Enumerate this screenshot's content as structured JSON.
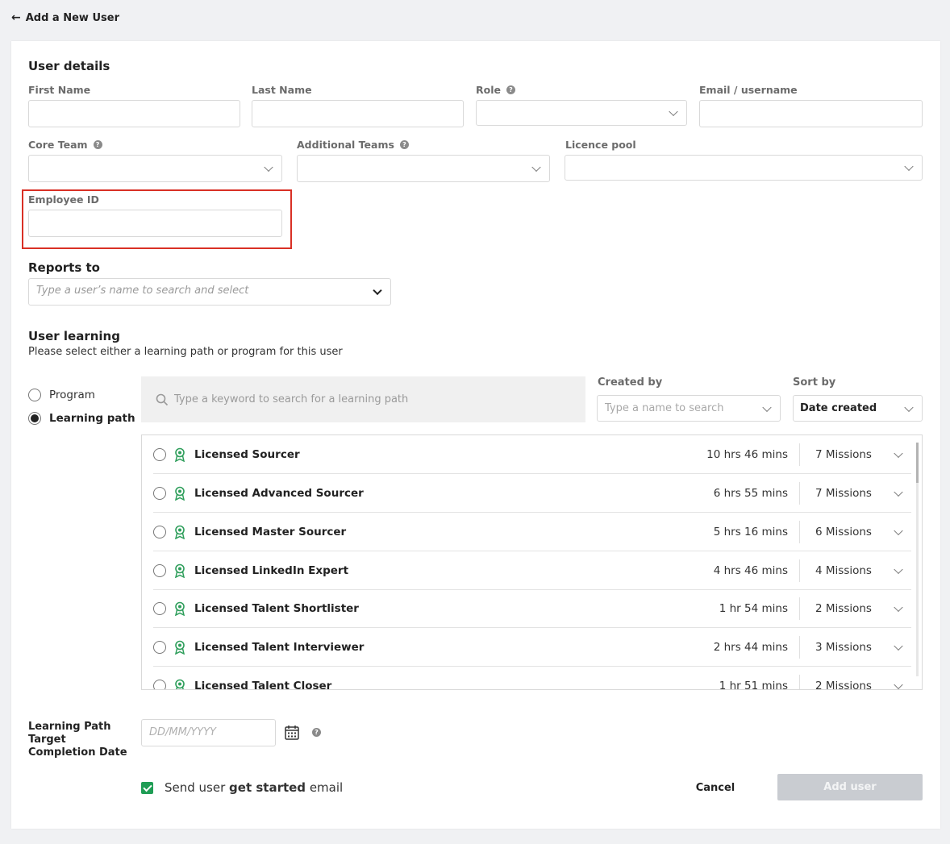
{
  "header": {
    "back_arrow": "←",
    "title": "Add a New User"
  },
  "user_details": {
    "heading": "User details",
    "first_name_label": "First Name",
    "last_name_label": "Last Name",
    "role_label": "Role",
    "email_label": "Email / username",
    "core_team_label": "Core Team",
    "additional_teams_label": "Additional Teams",
    "licence_pool_label": "Licence pool",
    "employee_id_label": "Employee ID",
    "help_glyph": "?"
  },
  "reports_to": {
    "heading": "Reports to",
    "placeholder": "Type a user’s name to search and select"
  },
  "user_learning": {
    "heading": "User learning",
    "subtitle": "Please select either a learning path or program for this user",
    "options": [
      {
        "label": "Program",
        "selected": false
      },
      {
        "label": "Learning path",
        "selected": true
      }
    ],
    "search_placeholder": "Type a keyword to search for a learning path",
    "created_by_label": "Created by",
    "created_by_placeholder": "Type a name to search",
    "sort_by_label": "Sort by",
    "sort_by_value": "Date created",
    "paths": [
      {
        "name": "Licensed Sourcer",
        "duration": "10 hrs 46 mins",
        "missions": "7 Missions"
      },
      {
        "name": "Licensed Advanced Sourcer",
        "duration": "6 hrs 55 mins",
        "missions": "7 Missions"
      },
      {
        "name": "Licensed Master Sourcer",
        "duration": "5 hrs 16 mins",
        "missions": "6 Missions"
      },
      {
        "name": "Licensed LinkedIn Expert",
        "duration": "4 hrs 46 mins",
        "missions": "4 Missions"
      },
      {
        "name": "Licensed Talent Shortlister",
        "duration": "1 hr 54 mins",
        "missions": "2 Missions"
      },
      {
        "name": "Licensed Talent Interviewer",
        "duration": "2 hrs 44 mins",
        "missions": "3 Missions"
      },
      {
        "name": "Licensed Talent Closer",
        "duration": "1 hr 51 mins",
        "missions": "2 Missions"
      }
    ]
  },
  "completion": {
    "label": "Learning Path Target Completion Date",
    "date_placeholder": "DD/MM/YYYY"
  },
  "footer": {
    "email_prefix": "Send user ",
    "email_bold": "get started",
    "email_suffix": " email",
    "cancel_label": "Cancel",
    "add_label": "Add user"
  },
  "colors": {
    "accent_green": "#1f9d55",
    "badge_green": "#2e9e5b",
    "highlight_red": "#d93025",
    "disabled_button": "#c9ccd1"
  }
}
